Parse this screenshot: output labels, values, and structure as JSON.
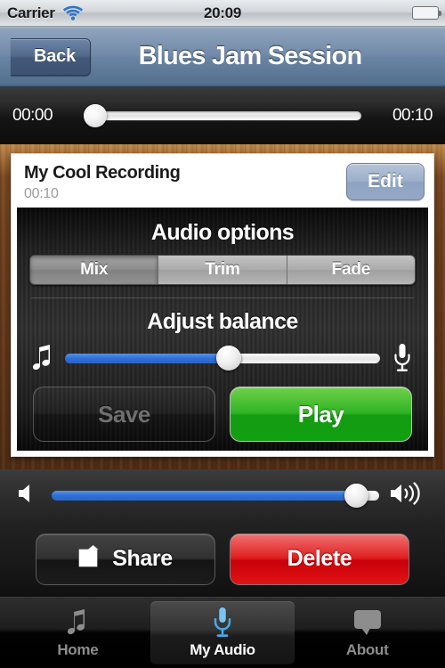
{
  "statusbar": {
    "carrier": "Carrier",
    "wifi_icon": "wifi-icon",
    "time": "20:09",
    "battery_icon": "battery-icon"
  },
  "navbar": {
    "back_label": "Back",
    "title": "Blues Jam Session"
  },
  "scrubber": {
    "elapsed": "00:00",
    "duration": "00:10",
    "progress_percent": 0
  },
  "recording": {
    "title": "My Cool Recording",
    "duration": "00:10",
    "edit_label": "Edit"
  },
  "audio_options": {
    "heading": "Audio options",
    "segments": [
      {
        "label": "Mix",
        "selected": true
      },
      {
        "label": "Trim",
        "selected": false
      },
      {
        "label": "Fade",
        "selected": false
      }
    ]
  },
  "balance": {
    "heading": "Adjust balance",
    "left_icon": "music-note-icon",
    "right_icon": "microphone-icon",
    "value_percent": 52
  },
  "actions": {
    "save_label": "Save",
    "save_disabled": true,
    "play_label": "Play"
  },
  "volume": {
    "low_icon": "speaker-mute-icon",
    "high_icon": "speaker-loud-icon",
    "value_percent": 93
  },
  "share_delete": {
    "share_label": "Share",
    "share_icon": "share-export-icon",
    "delete_label": "Delete"
  },
  "tabbar": {
    "items": [
      {
        "label": "Home",
        "icon": "music-note-icon",
        "active": false
      },
      {
        "label": "My Audio",
        "icon": "microphone-icon",
        "active": true
      },
      {
        "label": "About",
        "icon": "speech-bubble-icon",
        "active": false
      }
    ]
  },
  "colors": {
    "accent_blue": "#2f6fd6",
    "play_green": "#18a516",
    "delete_red": "#e02020",
    "navbar_blue": "#6a84a4",
    "wood_brown": "#6d3f1d"
  }
}
